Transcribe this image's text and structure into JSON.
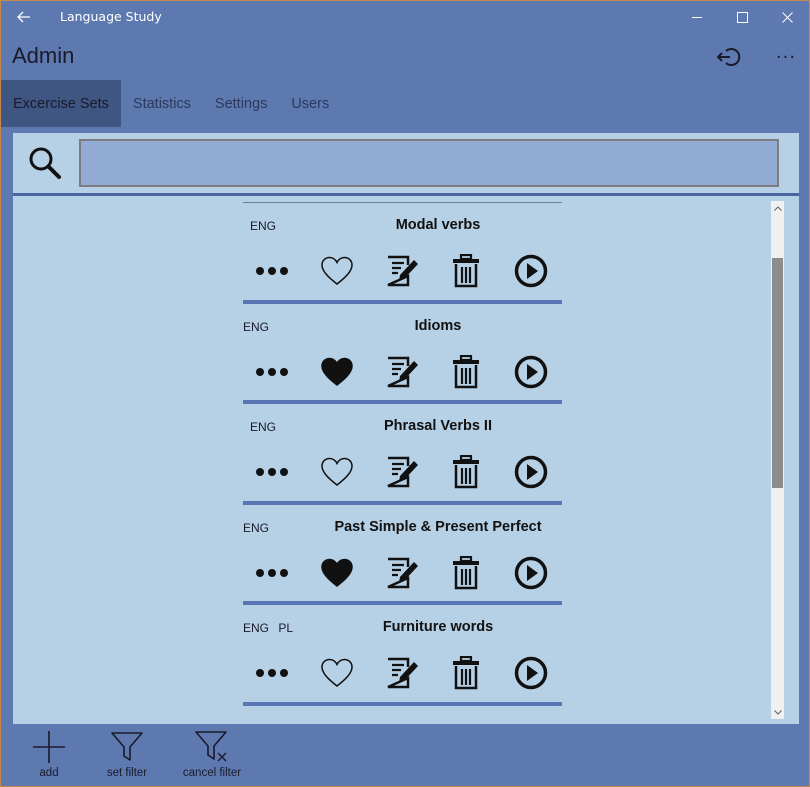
{
  "window": {
    "title": "Language Study"
  },
  "header": {
    "title": "Admin"
  },
  "tabs": [
    {
      "label": "Excercise Sets",
      "active": true
    },
    {
      "label": "Statistics",
      "active": false
    },
    {
      "label": "Settings",
      "active": false
    },
    {
      "label": "Users",
      "active": false
    }
  ],
  "search": {
    "value": "",
    "placeholder": ""
  },
  "exercise_sets": [
    {
      "langs": "ENG",
      "name": "Modal verbs",
      "favorite": false
    },
    {
      "langs": "ENG",
      "name": "Idioms",
      "favorite": true
    },
    {
      "langs": "ENG",
      "name": "Phrasal Verbs II",
      "favorite": false
    },
    {
      "langs": "ENG",
      "name": "Past Simple & Present Perfect",
      "favorite": true
    },
    {
      "langs": "ENG  PL",
      "name": "Furniture words",
      "favorite": false
    }
  ],
  "bottom_bar": {
    "add_label": "add",
    "set_filter_label": "set filter",
    "cancel_filter_label": "cancel filter"
  },
  "icons": {
    "back": "back-arrow-icon",
    "logout": "logout-icon",
    "more": "more-icon",
    "search": "search-icon",
    "item_more": "ellipsis-icon",
    "favorite": "heart-icon",
    "edit": "edit-icon",
    "delete": "trash-icon",
    "play": "play-icon",
    "add": "plus-icon",
    "set_filter": "filter-icon",
    "cancel_filter": "filter-cancel-icon"
  },
  "colors": {
    "window_bg": "#5e79b0",
    "content_bg": "#b6d1e6",
    "tab_active_bg": "#3f5582",
    "search_field_bg": "#93acd6",
    "separator": "#5a75b3"
  }
}
